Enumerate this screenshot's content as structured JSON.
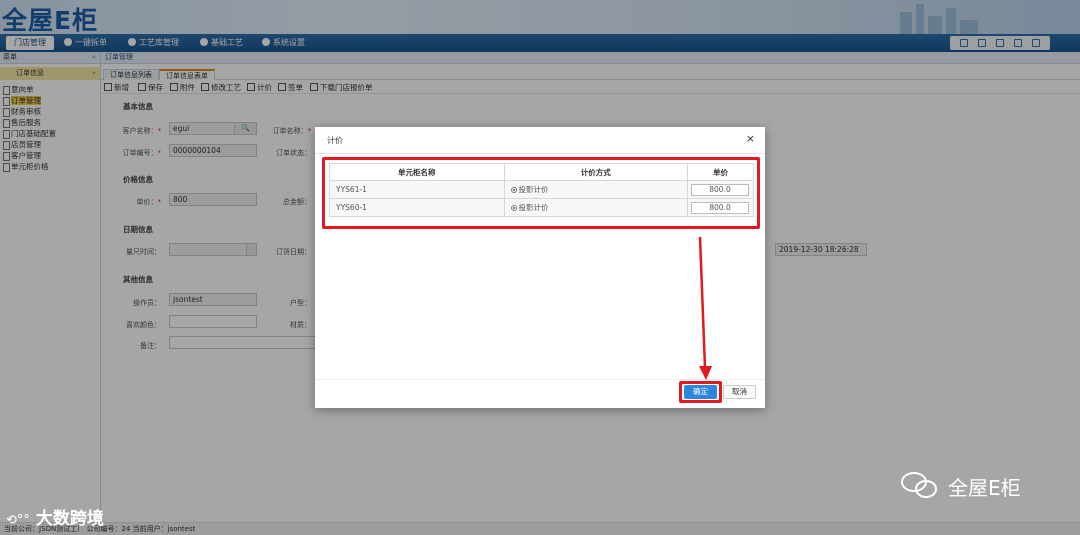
{
  "app": {
    "logo": "全屋E柜"
  },
  "nav": {
    "items": [
      "门店管理",
      "一键拆单",
      "工艺库管理",
      "基础工艺",
      "系统设置"
    ]
  },
  "sidebar": {
    "top": "菜单",
    "collapse": "«",
    "group": "订单信息",
    "group_toggle": "»",
    "items": [
      "意向单",
      "订单管理",
      "财务审核",
      "售后服务",
      "门店基础配置",
      "店员管理",
      "客户管理",
      "单元柜价格"
    ]
  },
  "main": {
    "breadcrumb": "订单管理",
    "tabs": [
      "订单信息列表",
      "订单信息表单"
    ],
    "toolbar": [
      "新增",
      "保存",
      "附件",
      "修改工艺",
      "计价",
      "签单",
      "下载门店报价单"
    ],
    "sections": {
      "basic": "基本信息",
      "price": "价格信息",
      "date": "日期信息",
      "other": "其他信息"
    },
    "fields": {
      "customer_name_label": "客户名称：",
      "customer_name_value": "egui",
      "order_name_label": "订单名称：",
      "order_no_label": "订单编号：",
      "order_no_value": "0000000104",
      "order_status_label": "订单状态：",
      "unit_price_label": "单价：",
      "unit_price_value": "800",
      "total_label": "总金额：",
      "measure_time_label": "量尺时间：",
      "order_date_label": "订货日期：",
      "date_value": "2019-12-30 18:26:28",
      "operator_label": "操作员：",
      "operator_value": "jsontest",
      "house_type_label": "户型：",
      "color_label": "喜欢颜色：",
      "material_label": "材质：",
      "remark_label": "备注："
    }
  },
  "footer": {
    "status": "当前公司：JSON测试工厂    公司编号：24    当前用户：jsontest"
  },
  "dialog": {
    "title": "计价",
    "close": "×",
    "headers": [
      "单元柜名称",
      "计价方式",
      "单价"
    ],
    "rows": [
      {
        "name": "YYS61-1",
        "method": "投影计价",
        "price": "800.0"
      },
      {
        "name": "YYS60-1",
        "method": "投影计价",
        "price": "800.0"
      }
    ],
    "ok": "确定",
    "cancel": "取消"
  },
  "watermarks": {
    "left": "大数跨境",
    "right": "全屋E柜"
  },
  "colors": {
    "highlight": "#e3191f",
    "primary": "#2e86de",
    "nav": "#1b5590"
  }
}
